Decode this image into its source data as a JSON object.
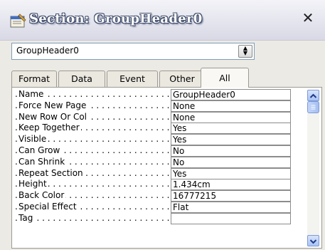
{
  "window": {
    "title": "Section: GroupHeader0",
    "close_label": "✕"
  },
  "selector": {
    "value": "GroupHeader0"
  },
  "tabs": [
    {
      "label": "Format"
    },
    {
      "label": "Data"
    },
    {
      "label": "Event"
    },
    {
      "label": "Other"
    },
    {
      "label": "All",
      "active": true
    }
  ],
  "properties": [
    {
      "name": "Name",
      "value": "GroupHeader0"
    },
    {
      "name": "Force New Page",
      "value": "None"
    },
    {
      "name": "New Row Or Col",
      "value": "None"
    },
    {
      "name": "Keep Together",
      "value": "Yes"
    },
    {
      "name": "Visible",
      "value": "Yes"
    },
    {
      "name": "Can Grow",
      "value": "No"
    },
    {
      "name": "Can Shrink",
      "value": "No"
    },
    {
      "name": "Repeat Section",
      "value": "Yes"
    },
    {
      "name": "Height",
      "value": "1.434cm"
    },
    {
      "name": "Back Color",
      "value": "16777215"
    },
    {
      "name": "Special Effect",
      "value": "Flat"
    },
    {
      "name": "Tag",
      "value": ""
    }
  ],
  "colors": {
    "accent": "#7c9ad6",
    "title_text": "#ffffff"
  }
}
